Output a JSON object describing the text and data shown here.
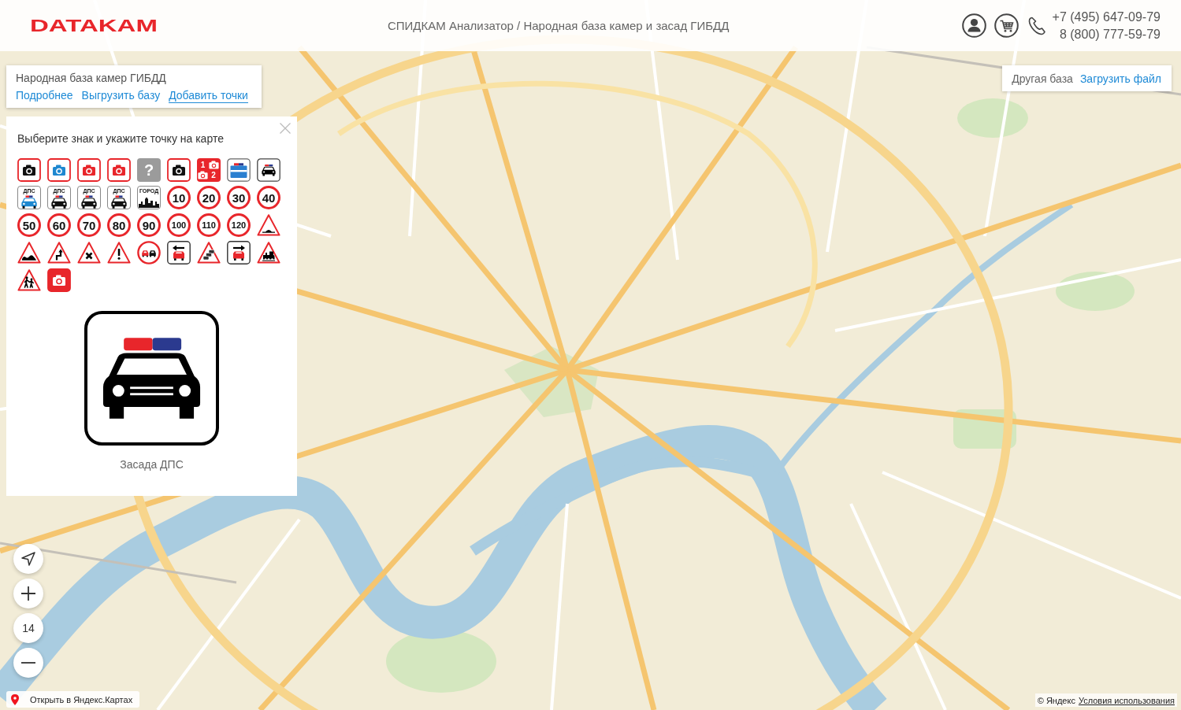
{
  "header": {
    "logo": "DATAKAM",
    "title": "СПИДКАМ Анализатор / Народная база камер и засад ГИБДД",
    "phones": [
      "+7 (495) 647-09-79",
      "8 (800) 777-59-79"
    ]
  },
  "info_panel": {
    "title": "Народная база камер ГИБДД",
    "links": [
      {
        "label": "Подробнее",
        "selected": false
      },
      {
        "label": "Выгрузить базу",
        "selected": false
      },
      {
        "label": "Добавить точки",
        "selected": true
      }
    ]
  },
  "base_panel": {
    "label": "Другая база",
    "link": "Загрузить файл"
  },
  "sign_panel": {
    "heading": "Выберите знак и укажите точку на карте",
    "signs": [
      {
        "kind": "camera",
        "color": "#111111"
      },
      {
        "kind": "camera",
        "color": "#1e88d0"
      },
      {
        "kind": "camera",
        "color": "#e8262b"
      },
      {
        "kind": "camera",
        "color": "#e8262b"
      },
      {
        "kind": "unknown",
        "text": "?"
      },
      {
        "kind": "camera",
        "color": "#111111"
      },
      {
        "kind": "multi-camera",
        "texts": [
          "1",
          "2"
        ]
      },
      {
        "kind": "post"
      },
      {
        "kind": "police-car"
      },
      {
        "kind": "dps-car",
        "text": "ДПС",
        "color": "#1e88d0"
      },
      {
        "kind": "dps-car",
        "text": "ДПС",
        "color": "#111111"
      },
      {
        "kind": "dps-car",
        "text": "ДПС",
        "color": "#111111"
      },
      {
        "kind": "dps-car",
        "text": "ДПС",
        "color": "#111111"
      },
      {
        "kind": "city",
        "text": "ГОРОД"
      },
      {
        "kind": "speed",
        "text": "10"
      },
      {
        "kind": "speed",
        "text": "20"
      },
      {
        "kind": "speed",
        "text": "30"
      },
      {
        "kind": "speed",
        "text": "40"
      },
      {
        "kind": "speed",
        "text": "50"
      },
      {
        "kind": "speed",
        "text": "60"
      },
      {
        "kind": "speed",
        "text": "70"
      },
      {
        "kind": "speed",
        "text": "80"
      },
      {
        "kind": "speed",
        "text": "90"
      },
      {
        "kind": "speed",
        "text": "100"
      },
      {
        "kind": "speed",
        "text": "110"
      },
      {
        "kind": "speed",
        "text": "120"
      },
      {
        "kind": "bump"
      },
      {
        "kind": "rough-road"
      },
      {
        "kind": "curve"
      },
      {
        "kind": "cross"
      },
      {
        "kind": "warning"
      },
      {
        "kind": "no-overtaking"
      },
      {
        "kind": "lane-left"
      },
      {
        "kind": "traffic-jam"
      },
      {
        "kind": "lane-right"
      },
      {
        "kind": "railway"
      },
      {
        "kind": "children"
      },
      {
        "kind": "camera-filled"
      }
    ],
    "preview": {
      "kind": "police-car",
      "label": "Засада ДПС"
    }
  },
  "zoom_controls": {
    "value": "14"
  },
  "map_footer": {
    "open_link": "Открыть в Яндекс.Картах",
    "copyright": "© Яндекс",
    "terms_link": "Условия использования"
  }
}
